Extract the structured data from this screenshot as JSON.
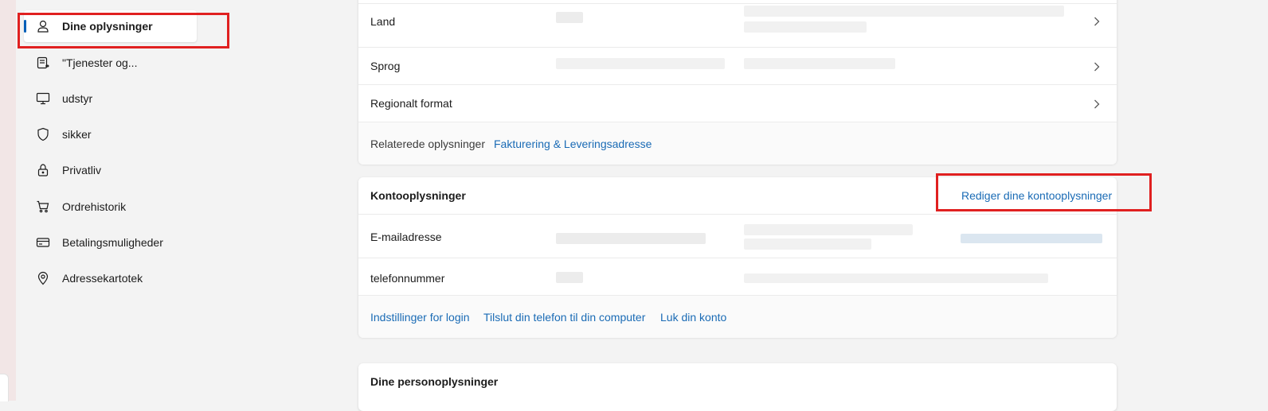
{
  "sidebar": {
    "items": [
      {
        "label": "Dine oplysninger",
        "icon": "person-icon",
        "selected": true
      },
      {
        "label": "\"Tjenester og...",
        "icon": "services-icon"
      },
      {
        "label": "udstyr",
        "icon": "monitor-icon"
      },
      {
        "label": "sikker",
        "icon": "shield-icon"
      },
      {
        "label": "Privatliv",
        "icon": "lock-icon"
      },
      {
        "label": "Ordrehistorik",
        "icon": "cart-icon"
      },
      {
        "label": "Betalingsmuligheder",
        "icon": "card-icon"
      },
      {
        "label": "Adressekartotek",
        "icon": "location-pin-icon"
      }
    ]
  },
  "region_card": {
    "rows": [
      {
        "label": "Land"
      },
      {
        "label": "Sprog"
      },
      {
        "label": "Regionalt format"
      }
    ],
    "related_label": "Relaterede oplysninger",
    "related_link": "Fakturering & Leveringsadresse"
  },
  "account_card": {
    "title": "Kontooplysninger",
    "edit_link": "Rediger dine kontooplysninger",
    "rows": [
      {
        "label": "E-mailadresse"
      },
      {
        "label": "telefonnummer"
      }
    ],
    "footer_links": [
      "Indstillinger for login",
      "Tilslut din telefon til din computer",
      "Luk din konto"
    ]
  },
  "personal_card": {
    "title": "Dine personoplysninger"
  },
  "colors": {
    "accent": "#005fb8",
    "link": "#1a6bb5",
    "highlight_box": "#e02020",
    "background": "#f3f3f3"
  }
}
